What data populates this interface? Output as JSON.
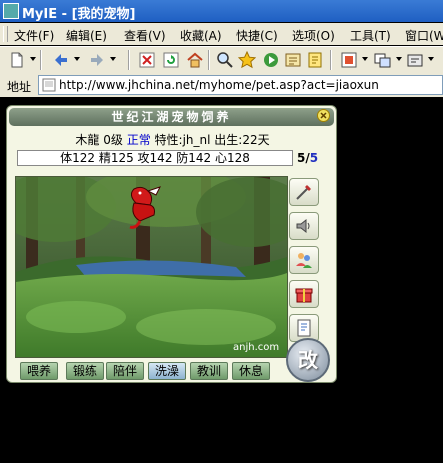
{
  "window": {
    "title": "MyIE - [我的宠物]"
  },
  "menu": {
    "items": [
      "文件(F)",
      "编辑(E)",
      "查看(V)",
      "收藏(A)",
      "快捷(C)",
      "选项(O)",
      "工具(T)",
      "窗口(W)"
    ]
  },
  "address": {
    "label": "地址",
    "url": "http://www.jhchina.net/myhome/pet.asp?act=jiaoxun"
  },
  "pet": {
    "header": "世纪江湖宠物饲养",
    "name": "木龍",
    "level": "0级",
    "status": "正常",
    "trait": "特性:jh_nl",
    "birth": "出生:22天",
    "stats": "体122 精125 攻142 防142 心128",
    "page_current": "5",
    "page_sep": "/",
    "page_total": "5",
    "watermark": "anjh.com",
    "change_label": "改",
    "actions": [
      "喂养",
      "锻练",
      "陪伴",
      "洗澡",
      "教训",
      "休息"
    ],
    "selected_action": "洗澡",
    "side_icons": [
      "sword-icon",
      "speaker-icon",
      "people-icon",
      "gift-icon",
      "note-icon"
    ]
  },
  "colors": {
    "titlebar": "#1f5fc2",
    "chrome": "#ece9d8",
    "status_normal": "#0000cc",
    "page_current": "#2030c0"
  }
}
